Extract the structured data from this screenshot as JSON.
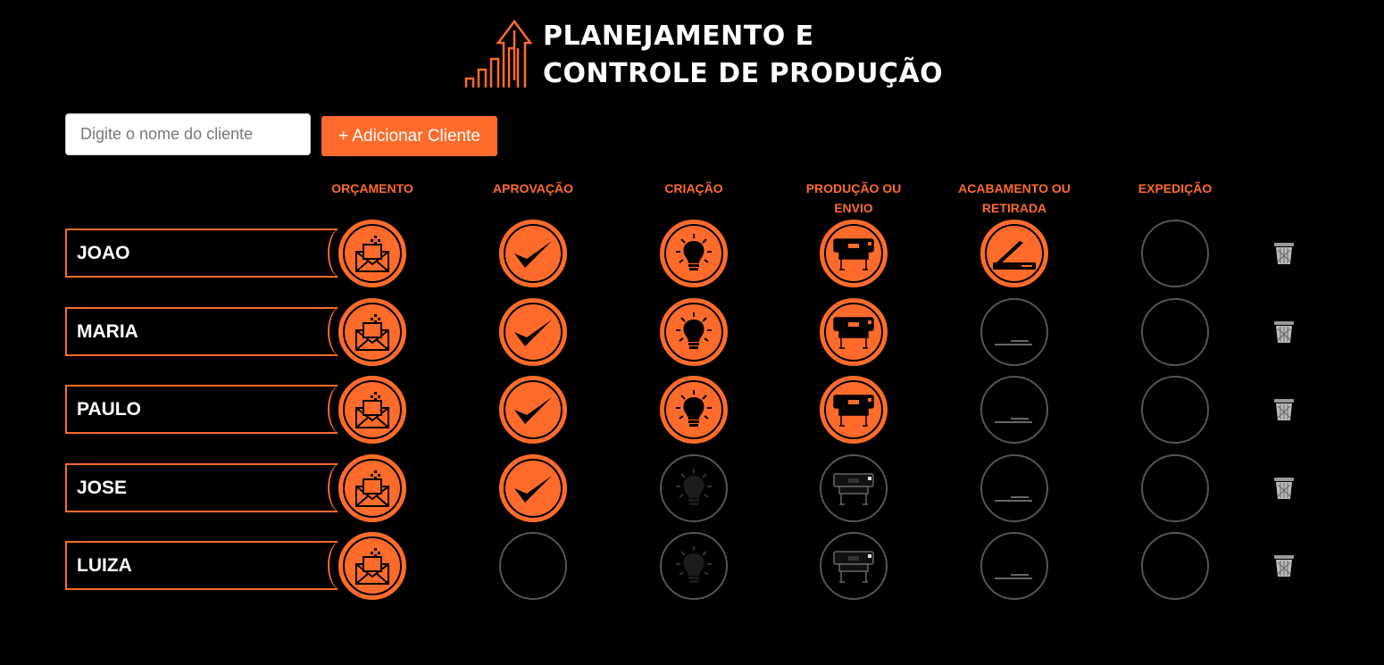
{
  "header": {
    "title_line1": "PLANEJAMENTO E",
    "title_line2": "CONTROLE DE PRODUÇÃO",
    "logo_icon": "growth-arrow-bars-icon"
  },
  "form": {
    "placeholder": "Digite o nome do cliente",
    "value": "",
    "add_button_label": "+ Adicionar Cliente"
  },
  "columns": [
    {
      "key": "orcamento",
      "label": "ORÇAMENTO",
      "icon": "envelope-icon"
    },
    {
      "key": "aprovacao",
      "label": "APROVAÇÃO",
      "icon": "checkmark-icon"
    },
    {
      "key": "criacao",
      "label": "CRIAÇÃO",
      "icon": "lightbulb-icon"
    },
    {
      "key": "producao",
      "label": "PRODUÇÃO OU ENVIO",
      "icon": "printer-icon"
    },
    {
      "key": "acabamento",
      "label": "ACABAMENTO OU RETIRADA",
      "icon": "scanner-icon"
    },
    {
      "key": "expedicao",
      "label": "EXPEDIÇÃO",
      "icon": "empty-circle-icon"
    }
  ],
  "clients": [
    {
      "name": "JOAO",
      "stages": [
        true,
        true,
        true,
        true,
        true,
        false
      ]
    },
    {
      "name": "MARIA",
      "stages": [
        true,
        true,
        true,
        true,
        false,
        false
      ]
    },
    {
      "name": "PAULO",
      "stages": [
        true,
        true,
        true,
        true,
        false,
        false
      ]
    },
    {
      "name": "JOSE",
      "stages": [
        true,
        true,
        false,
        false,
        false,
        false
      ]
    },
    {
      "name": "LUIZA",
      "stages": [
        true,
        false,
        false,
        false,
        false,
        false
      ]
    }
  ],
  "colors": {
    "accent": "#ff6b2b",
    "background": "#000000",
    "inactive_border": "#555555"
  },
  "delete_icon": "trash-icon"
}
